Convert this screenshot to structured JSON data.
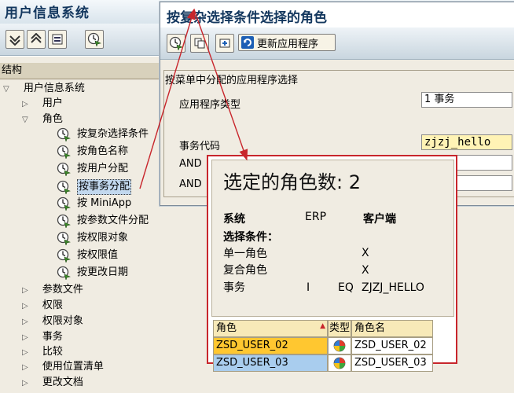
{
  "main_window": {
    "title": "用户信息系统",
    "toolbar_icons": [
      "expand-all-icon",
      "collapse-all-icon",
      "display-icon",
      "execute-icon"
    ]
  },
  "tree": {
    "header": "结构",
    "root": "用户信息系统",
    "items": [
      {
        "label": "用户",
        "level": 1,
        "expanded": false
      },
      {
        "label": "角色",
        "level": 1,
        "expanded": true
      },
      {
        "label": "按复杂选择条件",
        "level": 2,
        "icon": "clock-execute-icon"
      },
      {
        "label": "按角色名称",
        "level": 2,
        "icon": "clock-execute-icon"
      },
      {
        "label": "按用户分配",
        "level": 2,
        "icon": "clock-execute-icon"
      },
      {
        "label": "按事务分配",
        "level": 2,
        "icon": "clock-execute-icon",
        "selected": true
      },
      {
        "label": "按 MiniApp",
        "level": 2,
        "icon": "clock-execute-icon"
      },
      {
        "label": "按参数文件分配",
        "level": 2,
        "icon": "clock-execute-icon"
      },
      {
        "label": "按权限对象",
        "level": 2,
        "icon": "clock-execute-icon"
      },
      {
        "label": "按权限值",
        "level": 2,
        "icon": "clock-execute-icon"
      },
      {
        "label": "按更改日期",
        "level": 2,
        "icon": "clock-execute-icon"
      },
      {
        "label": "参数文件",
        "level": 1,
        "expanded": false
      },
      {
        "label": "权限",
        "level": 1,
        "expanded": false
      },
      {
        "label": "权限对象",
        "level": 1,
        "expanded": false
      },
      {
        "label": "事务",
        "level": 1,
        "expanded": false
      },
      {
        "label": "比较",
        "level": 1,
        "expanded": false
      },
      {
        "label": "使用位置清单",
        "level": 1,
        "expanded": false
      },
      {
        "label": "更改文档",
        "level": 1,
        "expanded": false
      }
    ]
  },
  "dialog": {
    "title": "按复杂选择条件选择的角色",
    "update_button": "更新应用程序",
    "group_title": "按菜单中分配的应用程序选择",
    "fields": {
      "app_type_label": "应用程序类型",
      "app_type_value": "1 事务",
      "trans_code_label": "事务代码",
      "trans_code_value": "zjzj_hello",
      "and_1": "AND",
      "and_2": "AND"
    }
  },
  "popup": {
    "heading": "选定的角色数: 2",
    "col_system": "系统",
    "col_erp": "ERP",
    "col_client": "客户端",
    "criteria_label": "选择条件：",
    "rows": [
      {
        "name": "单一角色",
        "i": "",
        "eq": "",
        "value": "X"
      },
      {
        "name": "复合角色",
        "i": "",
        "eq": "",
        "value": "X"
      },
      {
        "name": "事务",
        "i": "I",
        "eq": "EQ",
        "value": "ZJZJ_HELLO"
      }
    ],
    "table": {
      "headers": {
        "role": "角色",
        "type": "类型",
        "role_name": "角色名"
      },
      "rows": [
        {
          "role": "ZSD_USER_02",
          "type_icon": "single-role-icon",
          "role_name": "ZSD_USER_02",
          "color": "#ffc730"
        },
        {
          "role": "ZSD_USER_03",
          "type_icon": "single-role-icon",
          "role_name": "ZSD_USER_03",
          "color": "#a9cdee"
        }
      ]
    }
  },
  "colors": {
    "title_blue": "#13375e",
    "annotation_red": "#c8262c",
    "input_highlight": "#fff3b5"
  }
}
